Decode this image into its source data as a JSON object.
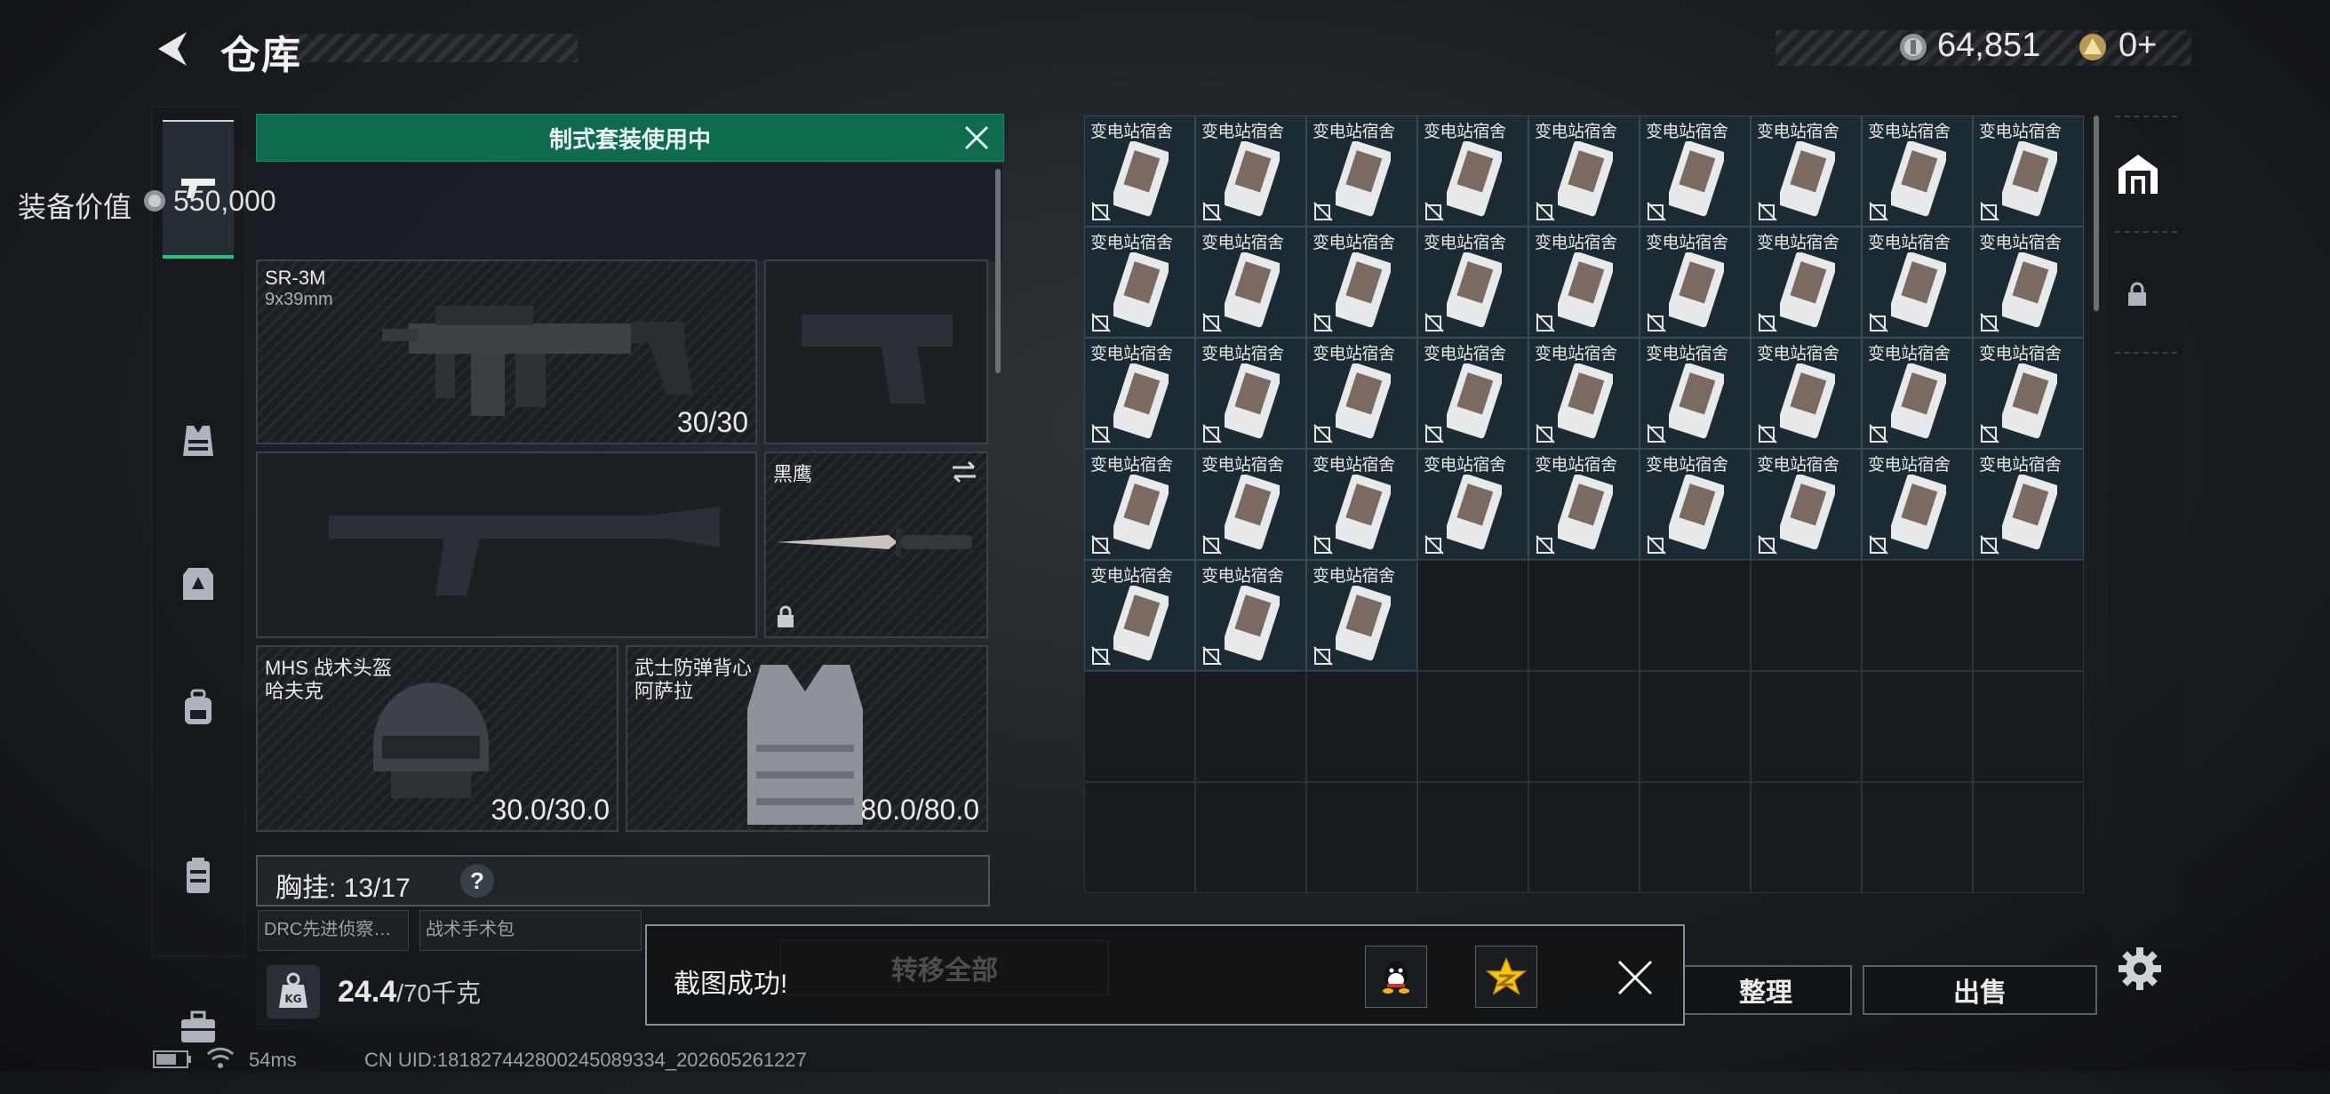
{
  "header": {
    "title": "仓库",
    "currency": {
      "coins": "64,851",
      "gold": "0",
      "gold_add": "+"
    }
  },
  "nav": [
    "weapon",
    "rig",
    "armor",
    "backpack",
    "case",
    "toolbox"
  ],
  "loadout": {
    "preset_banner": "制式套装使用中",
    "value_label": "装备价值",
    "value": "550,000",
    "primary": {
      "name": "SR-3M",
      "caliber": "9x39mm",
      "ammo": "30/30"
    },
    "melee": {
      "name": "黑鹰"
    },
    "helmet": {
      "name": "MHS 战术头盔",
      "sub": "哈夫克",
      "durability": "30.0/30.0"
    },
    "armor": {
      "name": "武士防弹背心",
      "sub": "阿萨拉",
      "durability": "80.0/80.0"
    },
    "rig": {
      "label": "胸挂:",
      "count": "13/17",
      "help": "?"
    },
    "rig_items": [
      "DRC先进侦察…",
      "战术手术包"
    ],
    "weight": {
      "current": "24.4",
      "max": "/70千克",
      "icon": "KG"
    }
  },
  "inventory": {
    "item_label": "变电站宿舍",
    "filled_count": 39,
    "columns": 9,
    "rows": 7
  },
  "buttons": {
    "sort": "整理",
    "sell": "出售"
  },
  "toast": {
    "message": "截图成功!",
    "behind_button": "转移全部"
  },
  "status": {
    "ping": "54ms",
    "uid": "CN UID:18182744280024508933‌4_202605261227"
  },
  "colors": {
    "accent_green": "#0f6b4d",
    "bg": "#1b1f23"
  }
}
